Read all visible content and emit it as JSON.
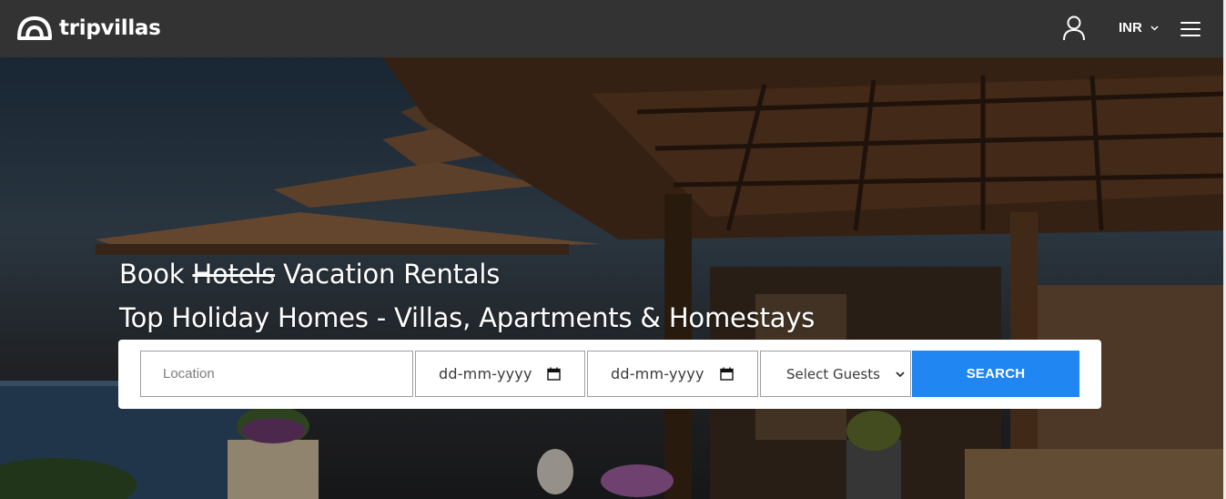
{
  "brand": {
    "name": "tripvillas"
  },
  "header": {
    "currency": "INR"
  },
  "hero": {
    "headline_prefix": "Book",
    "headline_strike": "Hotels",
    "headline_suffix": "Vacation Rentals",
    "subheadline": "Top Holiday Homes - Villas, Apartments & Homestays"
  },
  "search": {
    "location_placeholder": "Location",
    "checkin_placeholder": "dd-mm-yyyy",
    "checkout_placeholder": "dd-mm-yyyy",
    "guests_selected": "Select Guests",
    "button_label": "SEARCH"
  },
  "icons": {
    "logo": "tripvillas-arch-logo",
    "user": "user-icon",
    "currency_dropdown": "chevron-down-icon",
    "menu": "hamburger-menu-icon",
    "calendar": "calendar-icon"
  },
  "colors": {
    "navbar": "#333333",
    "search_button": "#1f86f2",
    "text_light": "#ffffff"
  }
}
